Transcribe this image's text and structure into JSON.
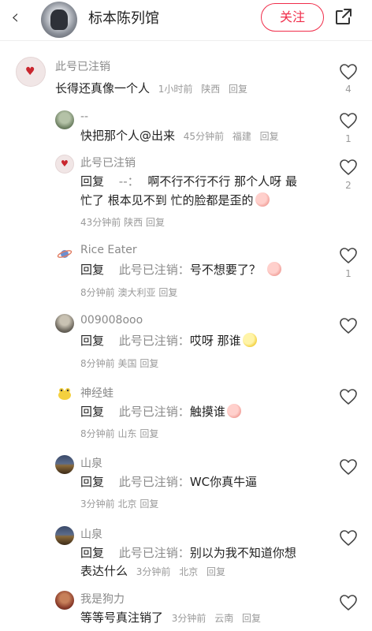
{
  "header": {
    "title": "标本陈列馆",
    "follow_label": "关注"
  },
  "comments": [
    {
      "user": "此号已注销",
      "text": "长得还真像一个人",
      "time": "1小时前",
      "location": "陕西",
      "reply": "回复",
      "likes": "4"
    },
    {
      "user": "--",
      "text": "快把那个人@出来",
      "time": "45分钟前",
      "location": "福建",
      "reply": "回复",
      "likes": "1"
    },
    {
      "user": "此号已注销",
      "reply_prefix": "回复",
      "target": "--：",
      "text_line1": "啊不行不行不行 那个人呀 最",
      "text_line2": "忙了 根本见不到 忙的脸都是歪的",
      "time": "43分钟前",
      "location": "陕西",
      "reply": "回复",
      "likes": "2"
    },
    {
      "user": "Rice Eater",
      "reply_prefix": "回复",
      "target": "此号已注销：",
      "text": "号不想要了？",
      "time": "8分钟前",
      "location": "澳大利亚",
      "reply": "回复",
      "likes": "1"
    },
    {
      "user": "009008ooo",
      "reply_prefix": "回复",
      "target": "此号已注销：",
      "text": "哎呀 那谁",
      "time": "8分钟前",
      "location": "美国",
      "reply": "回复",
      "likes": ""
    },
    {
      "user": "神经蛙",
      "reply_prefix": "回复",
      "target": "此号已注销：",
      "text": "触摸谁",
      "time": "8分钟前",
      "location": "山东",
      "reply": "回复",
      "likes": ""
    },
    {
      "user": "山泉",
      "reply_prefix": "回复",
      "target": "此号已注销：",
      "text": "WC你真牛逼",
      "time": "3分钟前",
      "location": "北京",
      "reply": "回复",
      "likes": ""
    },
    {
      "user": "山泉",
      "reply_prefix": "回复",
      "target": "此号已注销：",
      "text_line1": "别以为我不知道你想",
      "text_line2": "表达什么",
      "time": "3分钟前",
      "location": "北京",
      "reply": "回复",
      "likes": ""
    },
    {
      "user": "我是狗力",
      "text": "等等号真注销了",
      "time": "3分钟前",
      "location": "云南",
      "reply": "回复",
      "likes": ""
    }
  ],
  "colors": {
    "accent": "#f02d4a",
    "muted": "#8a8a8a"
  }
}
